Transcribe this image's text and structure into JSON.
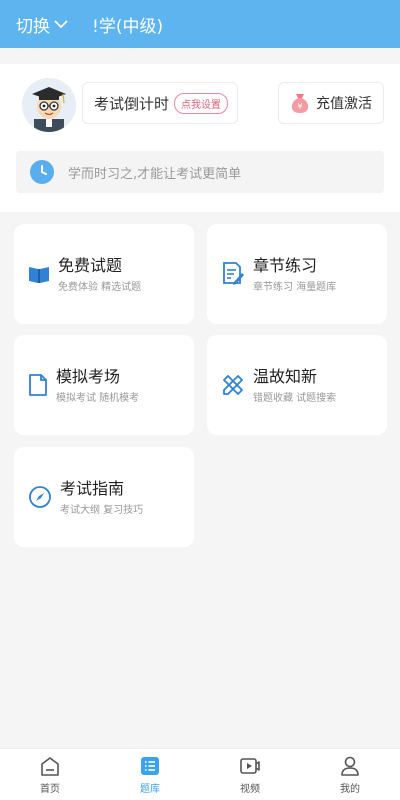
{
  "header": {
    "switch_label": "切换",
    "subject": "!学(中级)",
    "background_color": "#5db4ef"
  },
  "profile": {
    "countdown_label": "考试倒计时",
    "set_button": "点我设置",
    "recharge_label": "充值激活",
    "motto": "学而时习之,才能让考试更简单"
  },
  "cards": [
    {
      "title": "免费试题",
      "subtitle": "免费体验 精选试题",
      "icon": "open-book-icon"
    },
    {
      "title": "章节练习",
      "subtitle": "章节练习 海量题库",
      "icon": "document-edit-icon"
    },
    {
      "title": "模拟考场",
      "subtitle": "模拟考试 随机模考",
      "icon": "document-icon"
    },
    {
      "title": "温故知新",
      "subtitle": "错题收藏 试题搜索",
      "icon": "pencil-ruler-icon"
    },
    {
      "title": "考试指南",
      "subtitle": "考试大纲 复习技巧",
      "icon": "compass-icon"
    }
  ],
  "tabbar": {
    "items": [
      {
        "label": "首页",
        "icon": "home-icon"
      },
      {
        "label": "题库",
        "icon": "question-bank-icon",
        "active": true
      },
      {
        "label": "视频",
        "icon": "video-icon"
      },
      {
        "label": "我的",
        "icon": "user-icon"
      }
    ],
    "active_color": "#3aa3ee"
  }
}
